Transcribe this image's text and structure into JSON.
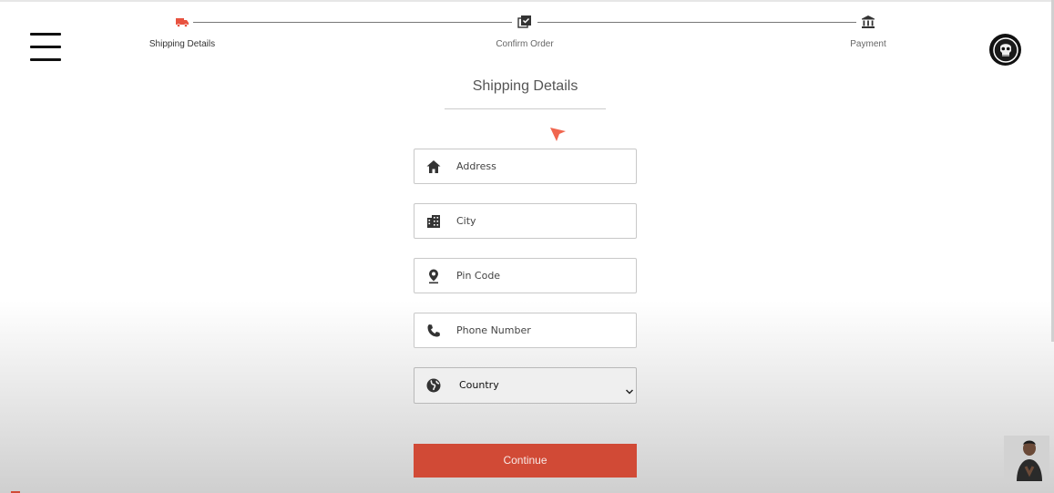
{
  "stepper": {
    "steps": [
      {
        "label": "Shipping Details",
        "icon": "truck-icon",
        "active": true
      },
      {
        "label": "Confirm Order",
        "icon": "checklist-icon",
        "active": false
      },
      {
        "label": "Payment",
        "icon": "bank-icon",
        "active": false
      }
    ],
    "active_color": "#e8523f"
  },
  "form": {
    "heading": "Shipping Details",
    "fields": [
      {
        "placeholder": "Address",
        "icon": "home-icon"
      },
      {
        "placeholder": "City",
        "icon": "building-icon"
      },
      {
        "placeholder": "Pin Code",
        "icon": "location-pin-icon"
      },
      {
        "placeholder": "Phone Number",
        "icon": "phone-icon"
      }
    ],
    "country": {
      "selected": "Country",
      "icon": "globe-icon"
    },
    "continue_label": "Continue"
  },
  "colors": {
    "accent": "#d14a36"
  }
}
